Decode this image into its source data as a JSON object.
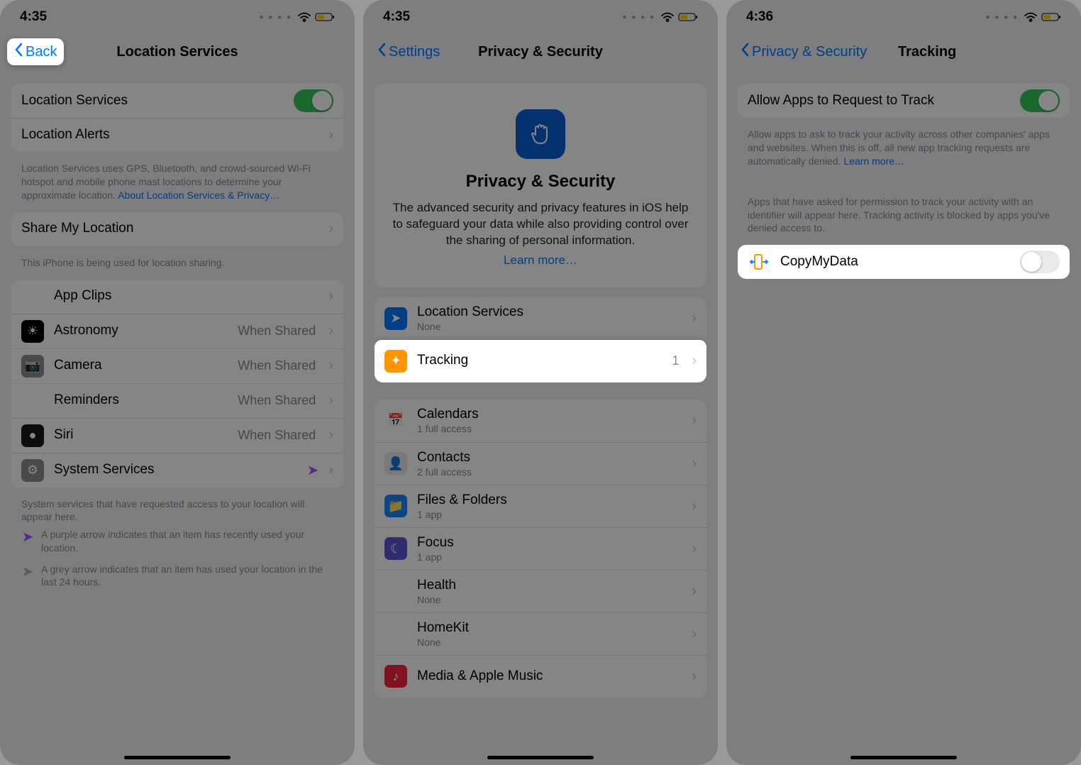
{
  "screen1": {
    "time": "4:35",
    "back": "Back",
    "title": "Location Services",
    "toggle_label": "Location Services",
    "alerts_label": "Location Alerts",
    "desc": "Location Services uses GPS, Bluetooth, and crowd-sourced Wi-Fi hotspot and mobile phone mast locations to determine your approximate location. ",
    "desc_link": "About Location Services & Privacy…",
    "share_label": "Share My Location",
    "share_footer": "This iPhone is being used for location sharing.",
    "apps": [
      {
        "name": "App Clips",
        "detail": "",
        "icon_bg": "#fff",
        "glyph": "◧"
      },
      {
        "name": "Astronomy",
        "detail": "When Shared",
        "icon_bg": "#000",
        "glyph": "☀"
      },
      {
        "name": "Camera",
        "detail": "When Shared",
        "icon_bg": "#8e8e93",
        "glyph": "📷"
      },
      {
        "name": "Reminders",
        "detail": "When Shared",
        "icon_bg": "#fff",
        "glyph": "⋮"
      },
      {
        "name": "Siri",
        "detail": "When Shared",
        "icon_bg": "#1a1a1a",
        "glyph": "●"
      },
      {
        "name": "System Services",
        "detail": "",
        "icon_bg": "#8e8e93",
        "glyph": "⚙",
        "arrow": true
      }
    ],
    "sys_footer": "System services that have requested access to your location will appear here.",
    "legend_purple": "A purple arrow indicates that an item has recently used your location.",
    "legend_grey": "A grey arrow indicates that an item has used your location in the last 24 hours."
  },
  "screen2": {
    "time": "4:35",
    "back": "Settings",
    "title": "Privacy & Security",
    "hero_title": "Privacy & Security",
    "hero_text": "The advanced security and privacy features in iOS help to safeguard your data while also providing control over the sharing of personal information.",
    "hero_link": "Learn more…",
    "group1": [
      {
        "name": "Location Services",
        "sub": "None",
        "icon_bg": "#007aff",
        "glyph": "➤"
      },
      {
        "name": "Tracking",
        "detail": "1",
        "icon_bg": "#ff9500",
        "glyph": "✦",
        "highlight": true
      }
    ],
    "group2": [
      {
        "name": "Calendars",
        "sub": "1 full access",
        "icon_bg": "#fff",
        "glyph": "📅"
      },
      {
        "name": "Contacts",
        "sub": "2 full access",
        "icon_bg": "#e9e9ee",
        "glyph": "👤"
      },
      {
        "name": "Files & Folders",
        "sub": "1 app",
        "icon_bg": "#1584ff",
        "glyph": "📁"
      },
      {
        "name": "Focus",
        "sub": "1 app",
        "icon_bg": "#5856d6",
        "glyph": "☾"
      },
      {
        "name": "Health",
        "sub": "None",
        "icon_bg": "#fff",
        "glyph": "❤"
      },
      {
        "name": "HomeKit",
        "sub": "None",
        "icon_bg": "#fff",
        "glyph": "⌂"
      },
      {
        "name": "Media & Apple Music",
        "sub": "",
        "icon_bg": "#fa233b",
        "glyph": "♪"
      }
    ]
  },
  "screen3": {
    "time": "4:36",
    "back": "Privacy & Security",
    "title": "Tracking",
    "allow_label": "Allow Apps to Request to Track",
    "allow_footer": "Allow apps to ask to track your activity across other companies' apps and websites. When this is off, all new app tracking requests are automatically denied. ",
    "allow_link": "Learn more…",
    "list_header": "Apps that have asked for permission to track your activity with an identifier will appear here. Tracking activity is blocked by apps you've denied access to.",
    "app_name": "CopyMyData"
  }
}
